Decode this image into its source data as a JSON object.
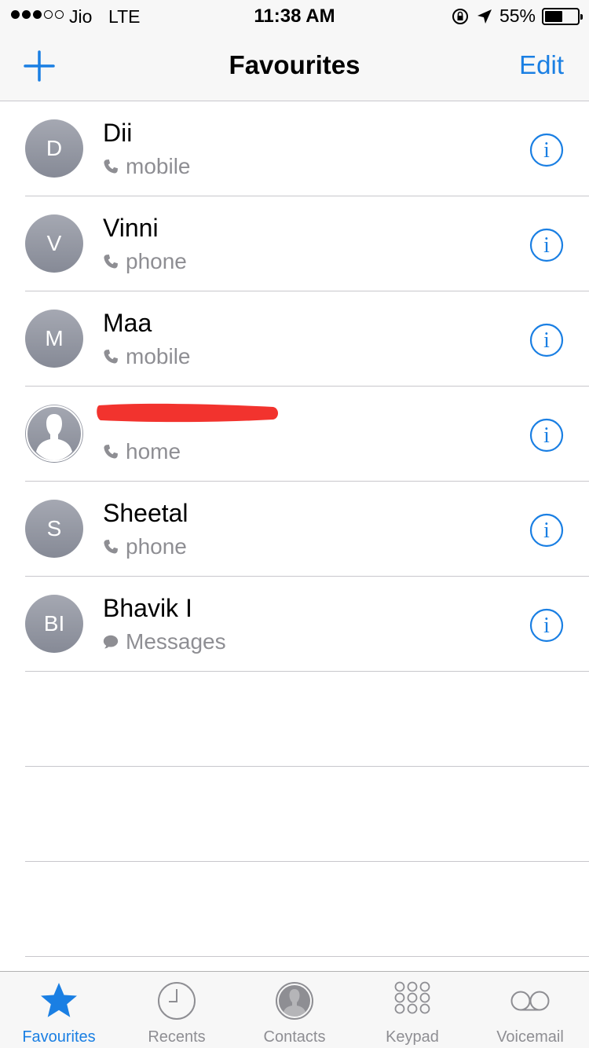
{
  "status_bar": {
    "carrier": "Jio",
    "network": "LTE",
    "time": "11:38 AM",
    "battery_percent_label": "55%",
    "battery_level": 0.55,
    "signal_bars_filled": 3,
    "signal_bars_total": 5
  },
  "nav": {
    "title": "Favourites",
    "edit_label": "Edit",
    "add_icon": "plus-icon"
  },
  "colors": {
    "accent": "#1a7fe3",
    "secondary_text": "#8e8e93",
    "avatar": "#9a9da6",
    "redaction": "#f2332e"
  },
  "favourites": [
    {
      "initials": "D",
      "name": "Dii",
      "type": "mobile",
      "type_icon": "phone-icon"
    },
    {
      "initials": "V",
      "name": "Vinni",
      "type": "phone",
      "type_icon": "phone-icon"
    },
    {
      "initials": "M",
      "name": "Maa",
      "type": "mobile",
      "type_icon": "phone-icon"
    },
    {
      "initials": "",
      "name": "",
      "type": "home",
      "type_icon": "phone-icon",
      "avatar": "person-silhouette",
      "name_redacted": true
    },
    {
      "initials": "S",
      "name": "Sheetal",
      "type": "phone",
      "type_icon": "phone-icon"
    },
    {
      "initials": "BI",
      "name": "Bhavik I",
      "type": "Messages",
      "type_icon": "message-bubble-icon"
    }
  ],
  "tabs": [
    {
      "label": "Favourites",
      "icon": "star-icon",
      "active": true
    },
    {
      "label": "Recents",
      "icon": "clock-icon",
      "active": false
    },
    {
      "label": "Contacts",
      "icon": "contacts-icon",
      "active": false
    },
    {
      "label": "Keypad",
      "icon": "keypad-icon",
      "active": false
    },
    {
      "label": "Voicemail",
      "icon": "voicemail-icon",
      "active": false
    }
  ]
}
